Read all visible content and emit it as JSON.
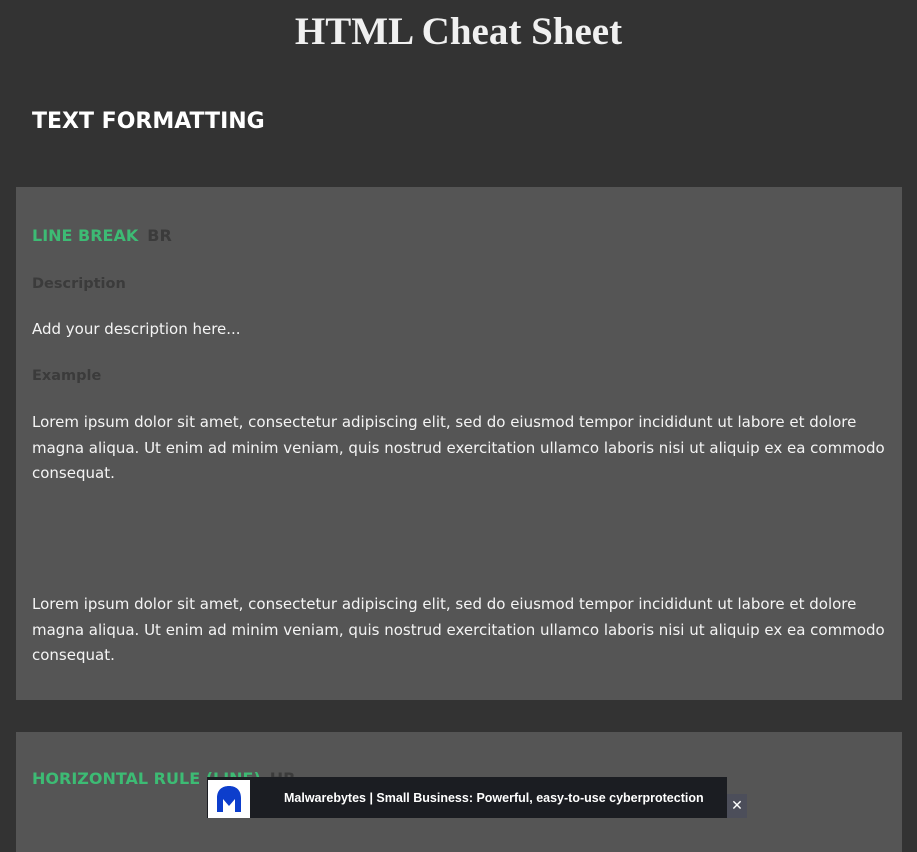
{
  "page": {
    "title": "HTML Cheat Sheet"
  },
  "section": {
    "heading": "TEXT FORMATTING"
  },
  "cards": [
    {
      "name": "LINE BREAK",
      "tag": "BR",
      "description_label": "Description",
      "description": "Add your description here...",
      "example_label": "Example",
      "example_paragraphs": [
        "Lorem ipsum dolor sit amet, consectetur adipiscing elit, sed do eiusmod tempor incididunt ut labore et dolore magna aliqua. Ut enim ad minim veniam, quis nostrud exercitation ullamco laboris nisi ut aliquip ex ea commodo consequat.",
        "Lorem ipsum dolor sit amet, consectetur adipiscing elit, sed do eiusmod tempor incididunt ut labore et dolore magna aliqua. Ut enim ad minim veniam, quis nostrud exercitation ullamco laboris nisi ut aliquip ex ea commodo consequat."
      ]
    },
    {
      "name": "HORIZONTAL RULE (LINE)",
      "tag": "HR"
    }
  ],
  "ad": {
    "logo_icon": "malwarebytes-logo-icon",
    "text": "Malwarebytes | Small Business: Powerful, easy-to-use cyberprotection",
    "close_label": "✕",
    "close_icon": "close-icon"
  },
  "colors": {
    "background": "#333333",
    "card_background": "#555555",
    "accent_green": "#3dbb74",
    "muted_label": "#3b3b3b",
    "ad_background": "#1b1d22",
    "malwarebytes_blue": "#0d3ecc"
  }
}
